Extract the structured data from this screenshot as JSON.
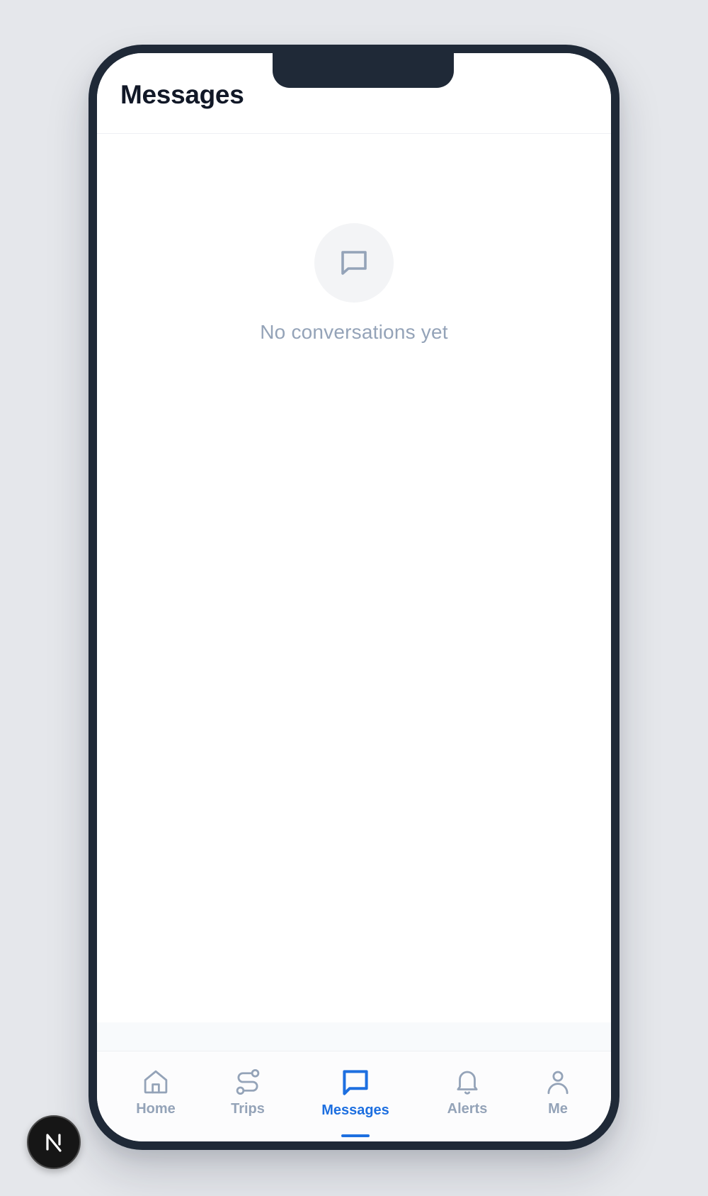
{
  "header": {
    "title": "Messages"
  },
  "empty_state": {
    "icon": "message-square-icon",
    "text": "No conversations yet"
  },
  "bottom_nav": {
    "active": "Messages",
    "accent_color": "#1d6fe0",
    "inactive_color": "#94a3b8",
    "items": [
      {
        "label": "Home",
        "icon": "home-icon"
      },
      {
        "label": "Trips",
        "icon": "route-icon"
      },
      {
        "label": "Messages",
        "icon": "message-square-icon"
      },
      {
        "label": "Alerts",
        "icon": "bell-icon"
      },
      {
        "label": "Me",
        "icon": "user-icon"
      }
    ]
  },
  "dev_badge": {
    "icon": "next-logo-icon"
  }
}
